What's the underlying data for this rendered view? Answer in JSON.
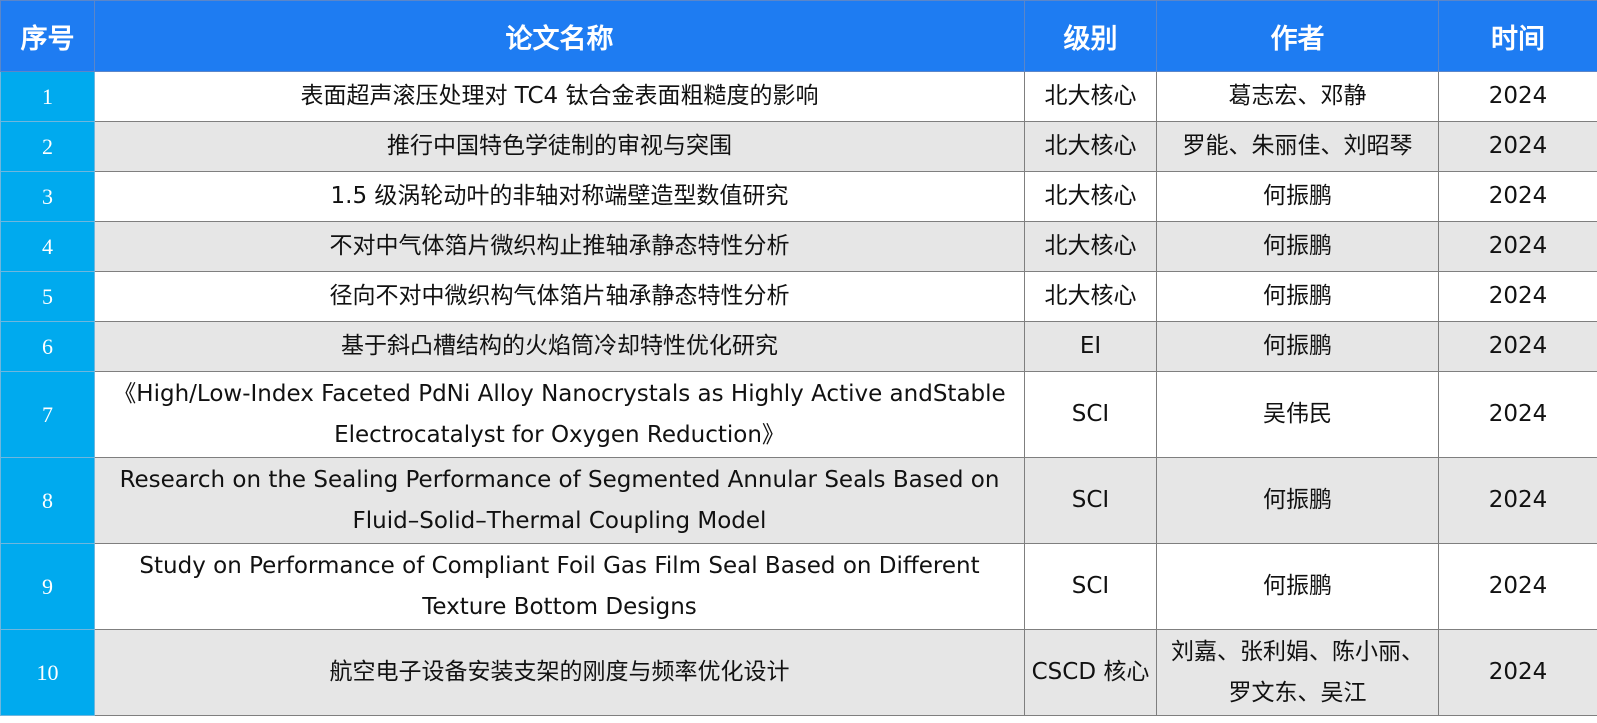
{
  "header": {
    "no": "序号",
    "title": "论文名称",
    "level": "级别",
    "author": "作者",
    "year": "时间"
  },
  "rows": [
    {
      "no": "1",
      "title": "表面超声滚压处理对 TC4 钛合金表面粗糙度的影响",
      "level": "北大核心",
      "author": "葛志宏、邓静",
      "year": "2024"
    },
    {
      "no": "2",
      "title": "推行中国特色学徒制的审视与突围",
      "level": "北大核心",
      "author": "罗能、朱丽佳、刘昭琴",
      "year": "2024"
    },
    {
      "no": "3",
      "title": "1.5 级涡轮动叶的非轴对称端壁造型数值研究",
      "level": "北大核心",
      "author": "何振鹏",
      "year": "2024"
    },
    {
      "no": "4",
      "title": "不对中气体箔片微织构止推轴承静态特性分析",
      "level": "北大核心",
      "author": "何振鹏",
      "year": "2024"
    },
    {
      "no": "5",
      "title": "径向不对中微织构气体箔片轴承静态特性分析",
      "level": "北大核心",
      "author": "何振鹏",
      "year": "2024"
    },
    {
      "no": "6",
      "title": "基于斜凸槽结构的火焰筒冷却特性优化研究",
      "level": "EI",
      "author": "何振鹏",
      "year": "2024"
    },
    {
      "no": "7",
      "title": "《High/Low-Index Faceted PdNi Alloy Nanocrystals as Highly Active andStable Electrocatalyst for Oxygen Reduction》",
      "level": "SCI",
      "author": "吴伟民",
      "year": "2024"
    },
    {
      "no": "8",
      "title": "Research on the Sealing Performance of Segmented Annular Seals Based on Fluid–Solid–Thermal Coupling Model",
      "level": "SCI",
      "author": "何振鹏",
      "year": "2024"
    },
    {
      "no": "9",
      "title": "Study on Performance of Compliant Foil Gas Film Seal Based on Different Texture Bottom Designs",
      "level": "SCI",
      "author": "何振鹏",
      "year": "2024"
    },
    {
      "no": "10",
      "title": "航空电子设备安装支架的刚度与频率优化设计",
      "level": "CSCD 核心",
      "author": "刘嘉、张利娟、陈小丽、罗文东、吴江",
      "year": "2024"
    }
  ]
}
